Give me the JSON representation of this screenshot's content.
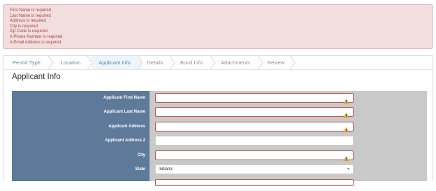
{
  "alert": {
    "messages": [
      "First Name is required",
      "Last Name is required",
      "Address is required",
      "City is required",
      "Zip Code is required",
      "A Phone Number is required",
      "A Email Address is required."
    ]
  },
  "wizard": {
    "steps": [
      {
        "label": "Permit Type",
        "state": "done"
      },
      {
        "label": "Location",
        "state": "done"
      },
      {
        "label": "Applicant Info",
        "state": "active"
      },
      {
        "label": "Details",
        "state": "pending"
      },
      {
        "label": "Bond Info",
        "state": "pending"
      },
      {
        "label": "Attachments",
        "state": "pending"
      },
      {
        "label": "Review",
        "state": "pending"
      }
    ]
  },
  "section": {
    "title": "Applicant Info"
  },
  "form": {
    "fields": [
      {
        "label": "Applicant First Name",
        "value": "",
        "error": true
      },
      {
        "label": "Applicant Last Name",
        "value": "",
        "error": true
      },
      {
        "label": "Applicant Address",
        "value": "",
        "error": true
      },
      {
        "label": "Applicant Address 2",
        "value": "",
        "error": false
      },
      {
        "label": "City",
        "value": "",
        "error": true
      },
      {
        "label": "State",
        "value": "Indiana",
        "error": false
      }
    ]
  },
  "colors": {
    "alert_bg": "#f2dede",
    "alert_text": "#a94442",
    "active_step": "#3f8fc0",
    "label_column": "#5e7a9a",
    "error_border": "#c0584f",
    "warning_icon": "#e8a33a"
  }
}
